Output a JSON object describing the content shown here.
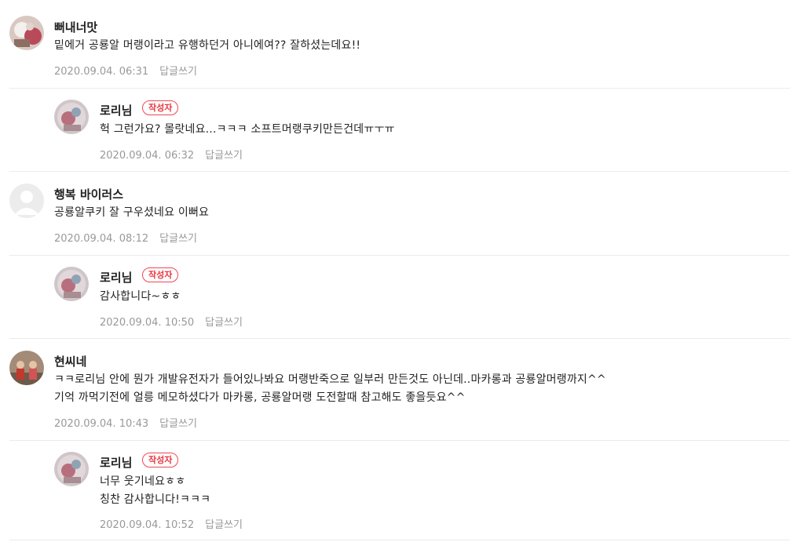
{
  "comments": [
    {
      "author": "뻐내너맛",
      "lines": [
        "밑에거 공룡알 머랭이라고 유행하던거 아니에여?? 잘하셨는데요!!"
      ],
      "date": "2020.09.04. 06:31",
      "reply_label": "답글쓰기",
      "avatar_icon": "cake-photo-avatar"
    },
    {
      "author": "로리님",
      "badge": "작성자",
      "lines": [
        "헉 그런가요? 몰랏네요...ㅋㅋㅋ 소프트머랭쿠키만든건데ㅠㅜㅠ"
      ],
      "date": "2020.09.04. 06:32",
      "reply_label": "답글쓰기",
      "avatar_icon": "author-photo-avatar"
    },
    {
      "author": "행복 바이러스",
      "lines": [
        "공룡알쿠키 잘 구우셨네요 이뻐요"
      ],
      "date": "2020.09.04. 08:12",
      "reply_label": "답글쓰기",
      "avatar_icon": "default-user-avatar"
    },
    {
      "author": "로리님",
      "badge": "작성자",
      "lines": [
        "감사합니다~ㅎㅎ"
      ],
      "date": "2020.09.04. 10:50",
      "reply_label": "답글쓰기",
      "avatar_icon": "author-photo-avatar"
    },
    {
      "author": "현씨네",
      "lines": [
        "ㅋㅋ로리님 안에 뭔가 개발유전자가 들어있나봐요 머랭반죽으로 일부러 만든것도 아닌데..마카롱과 공룡알머랭까지^^",
        "기억 까먹기전에 얼릉 메모하셨다가 마카롱, 공룡알머랭 도전할때 참고해도 좋을듯요^^"
      ],
      "date": "2020.09.04. 10:43",
      "reply_label": "답글쓰기",
      "avatar_icon": "family-photo-avatar"
    },
    {
      "author": "로리님",
      "badge": "작성자",
      "lines": [
        "너무 웃기네요ㅎㅎ",
        "칭찬 감사합니다!ㅋㅋㅋ"
      ],
      "date": "2020.09.04. 10:52",
      "reply_label": "답글쓰기",
      "avatar_icon": "author-photo-avatar"
    }
  ],
  "colors": {
    "badge": "#e8333d",
    "meta": "#999999",
    "divider": "#ebebeb"
  }
}
